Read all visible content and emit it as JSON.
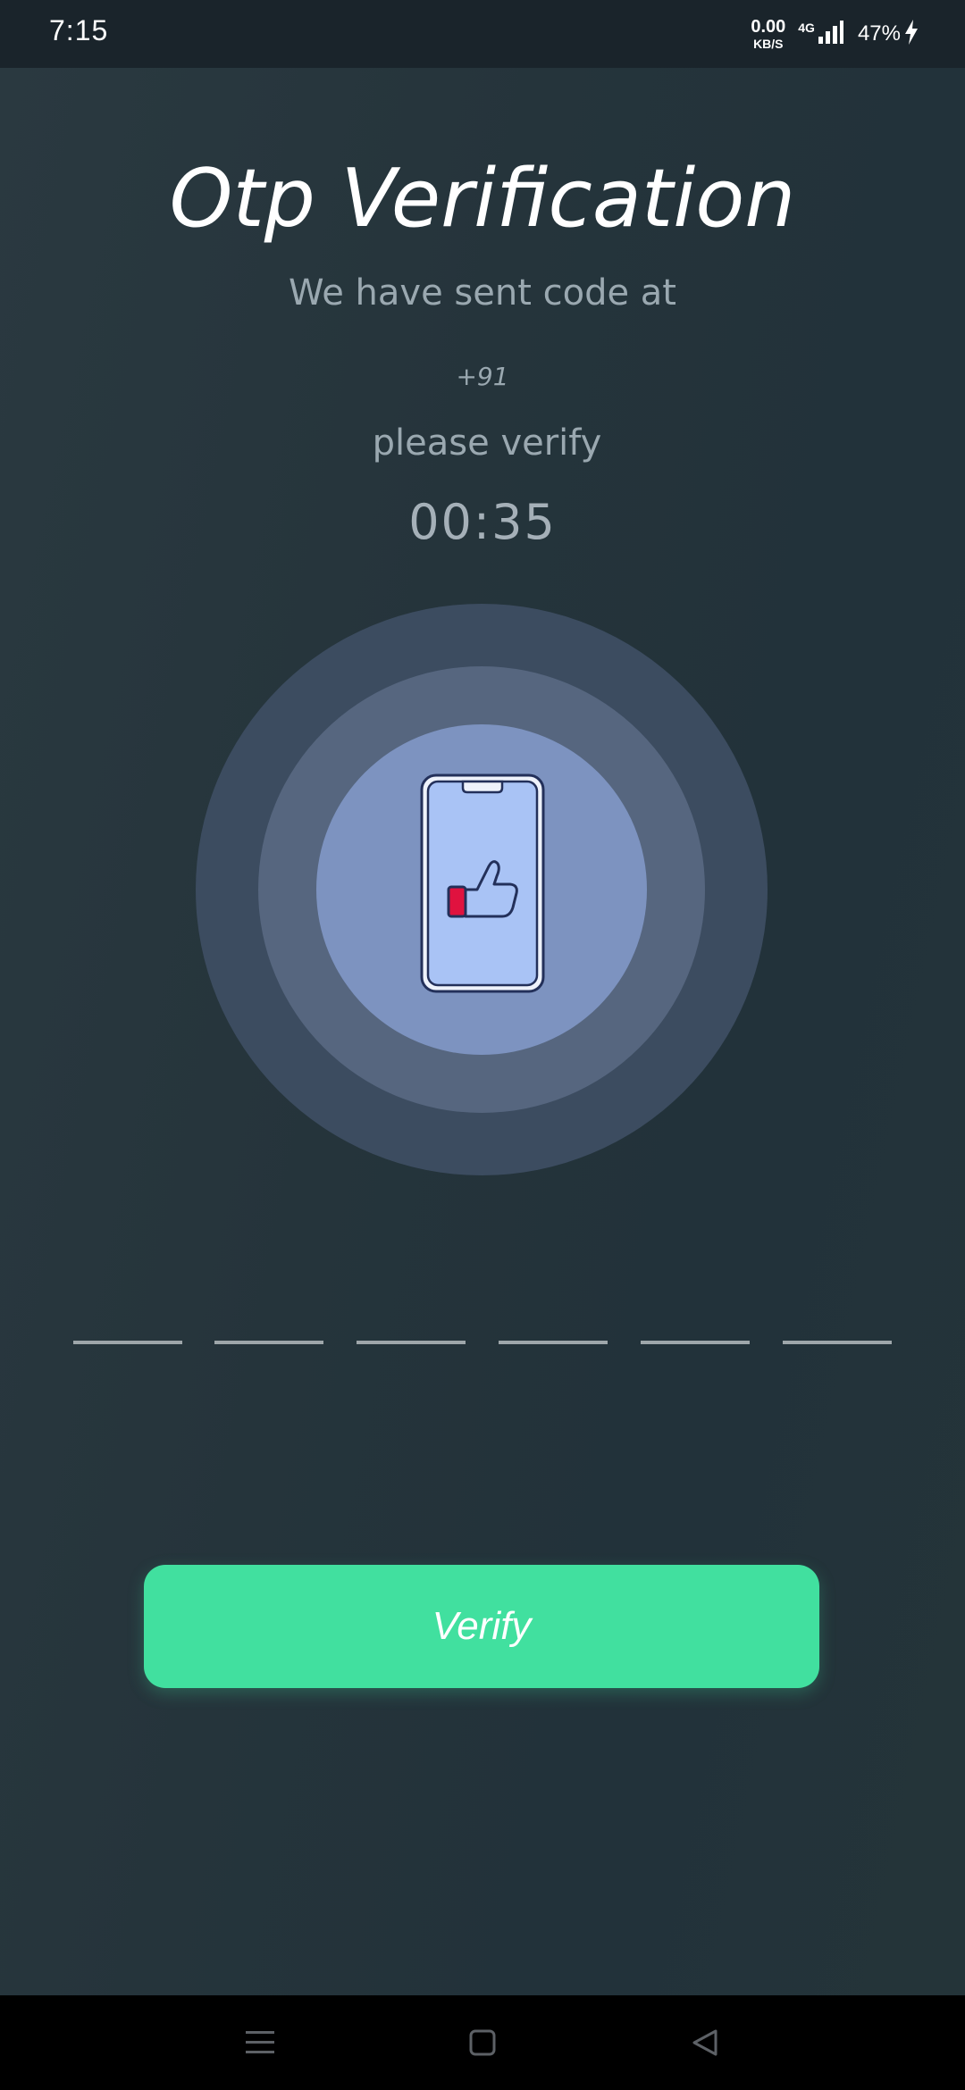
{
  "status_bar": {
    "time": "7:15",
    "net_speed_value": "0.00",
    "net_speed_unit": "KB/S",
    "network_type": "4G",
    "battery": "47%",
    "icons": [
      "signal-icon",
      "charging-bolt-icon"
    ]
  },
  "screen": {
    "title": "Otp Verification",
    "sent_text": "We have sent code at",
    "phone_prefix": "+91",
    "verify_text": "please verify",
    "timer": "00:35"
  },
  "illustration": {
    "icon": "phone-thumbs-up-icon",
    "colors": {
      "outer_ring": "#3c4c60",
      "middle_ring": "#56667f",
      "inner_circle": "#7d93c0",
      "phone_screen": "#a9c3f5",
      "outline": "#23305a",
      "accent": "#e0123f"
    }
  },
  "otp": {
    "slots": [
      "",
      "",
      "",
      "",
      "",
      ""
    ]
  },
  "actions": {
    "verify_label": "Verify"
  },
  "nav_bar": {
    "icons": [
      "menu-icon",
      "home-square-icon",
      "back-triangle-icon"
    ]
  },
  "colors": {
    "background": "#22313a",
    "button": "#41e09f",
    "text_muted": "#9aa8b0"
  }
}
